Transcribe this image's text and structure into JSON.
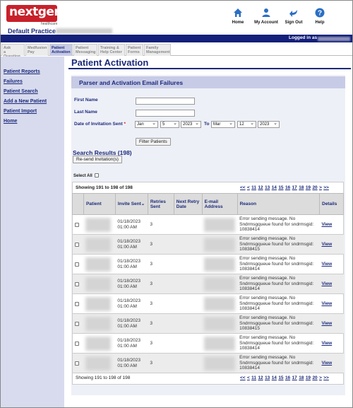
{
  "brand": {
    "logo_text": "nextgen",
    "logo_sub": "healthcare",
    "accent": "#c8202a",
    "navy": "#1c2a7a"
  },
  "practice": "Default Practice -",
  "header_buttons": [
    {
      "label": "Home",
      "icon": "house-icon"
    },
    {
      "label": "My Account",
      "icon": "person-icon"
    },
    {
      "label": "Sign Out",
      "icon": "sign-out-arrow-icon"
    },
    {
      "label": "Help",
      "icon": "question-circle-icon"
    }
  ],
  "logged_in": "Logged in as",
  "tabs": [
    {
      "line1": "Ask",
      "line2": "a Question"
    },
    {
      "line1": "Medfusion",
      "line2": "Pay"
    },
    {
      "line1": "Patient",
      "line2": "Activation"
    },
    {
      "line1": "Patient",
      "line2": "Messaging"
    },
    {
      "line1": "Training &",
      "line2": "Help Center"
    },
    {
      "line1": "Patient",
      "line2": "Forms"
    },
    {
      "line1": "Family",
      "line2": "Management"
    }
  ],
  "sidebar": [
    "Patient Reports",
    "Failures",
    "Patient Search",
    "Add a New Patient",
    "Patient Import",
    "Home"
  ],
  "page_title": "Patient Activation",
  "panel_title": "Parser and Activation Email Failures",
  "form": {
    "first_name_label": "First Name",
    "last_name_label": "Last Name",
    "date_label": "Date of Invitation Sent",
    "required_mark": "*",
    "to_label": "To",
    "from_month": "Jan",
    "from_day": "5",
    "from_year": "2023",
    "to_month": "Mar",
    "to_day": "12",
    "to_year": "2023",
    "filter_button": "Filter Patients"
  },
  "results_title": "Search Results (198)",
  "resend_button": "Re-send Invitation(s)",
  "select_all": "Select All",
  "showing": "Showing 191 to 198 of 198",
  "pager": [
    "<<",
    "<",
    "11",
    "12",
    "13",
    "14",
    "15",
    "16",
    "17",
    "18",
    "19",
    "20",
    ">",
    ">>"
  ],
  "columns": [
    "",
    "Patient",
    "Invite Sent",
    "Retries Sent",
    "Next Retry Date",
    "E-mail Address",
    "Reason",
    "Details"
  ],
  "rows": [
    {
      "date": "01/18/2023",
      "time": "01:00 AM",
      "retries": "3",
      "reason": "Error sending message. No Sndrmsgqueue found for sndrmsgid: 10838414",
      "details": "View"
    },
    {
      "date": "01/18/2023",
      "time": "01:00 AM",
      "retries": "3",
      "reason": "Error sending message. No Sndrmsgqueue found for sndrmsgid: 10838415",
      "details": "View"
    },
    {
      "date": "01/18/2023",
      "time": "01:00 AM",
      "retries": "3",
      "reason": "Error sending message. No Sndrmsgqueue found for sndrmsgid: 10838414",
      "details": "View"
    },
    {
      "date": "01/18/2023",
      "time": "01:00 AM",
      "retries": "3",
      "reason": "Error sending message. No Sndrmsgqueue found for sndrmsgid: 10838414",
      "details": "View"
    },
    {
      "date": "01/18/2023",
      "time": "01:00 AM",
      "retries": "3",
      "reason": "Error sending message. No Sndrmsgqueue found for sndrmsgid: 10838414",
      "details": "View"
    },
    {
      "date": "01/18/2023",
      "time": "01:00 AM",
      "retries": "3",
      "reason": "Error sending message. No Sndrmsgqueue found for sndrmsgid: 10838415",
      "details": "View"
    },
    {
      "date": "01/18/2023",
      "time": "01:00 AM",
      "retries": "3",
      "reason": "Error sending message. No Sndrmsgqueue found for sndrmsgid: 10838414",
      "details": "View"
    },
    {
      "date": "01/18/2023",
      "time": "01:00 AM",
      "retries": "3",
      "reason": "Error sending message. No Sndrmsgqueue found for sndrmsgid: 10838414",
      "details": "View"
    }
  ]
}
